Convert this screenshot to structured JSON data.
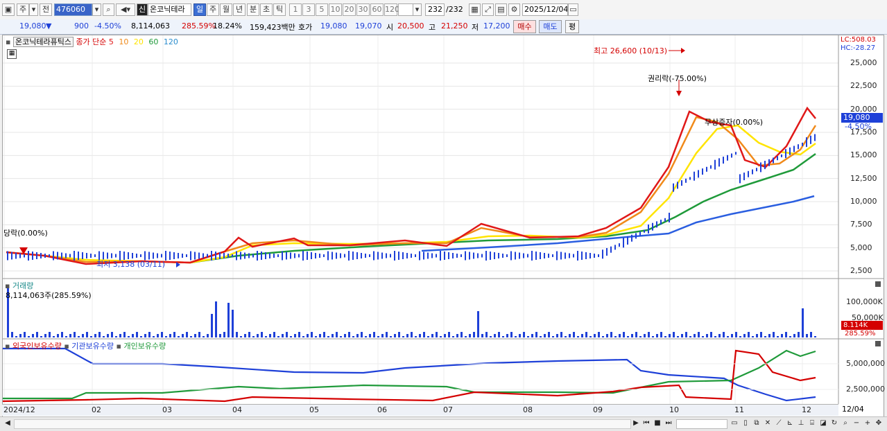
{
  "toolbar": {
    "market": "주",
    "prev_label": "전",
    "stock_code": "476060",
    "stock_name": "온코닉테라",
    "new_badge": "신",
    "periods": [
      "일",
      "주",
      "월",
      "년",
      "분",
      "초",
      "틱"
    ],
    "active_period": "일",
    "intervals": [
      "1",
      "3",
      "5",
      "10",
      "20",
      "30",
      "60",
      "120"
    ],
    "count": "232",
    "count_total": "/232",
    "date": "2025/12/04"
  },
  "info": {
    "price": "19,080",
    "price_arrow": "▼",
    "change": "900",
    "change_rate": "-4.50%",
    "volume": "8,114,063",
    "volume_rate": "285.59%",
    "turnover_rate": "18.24%",
    "trade_value": "159,423백만",
    "bid_label": "호가",
    "bid1": "19,080",
    "bid2": "19,070",
    "open_label": "시",
    "open": "20,500",
    "high_label": "고",
    "high": "21,250",
    "low_label": "저",
    "low": "17,200",
    "buy_label": "매수",
    "sell_label": "매도",
    "eval_label": "평"
  },
  "price_panel": {
    "stock_title": "온코닉테라퓨틱스",
    "ma_label": "종가 단순",
    "ma_periods": [
      {
        "label": "5",
        "color": "#e01818"
      },
      {
        "label": "10",
        "color": "#f08a1a"
      },
      {
        "label": "20",
        "color": "#ffe400"
      },
      {
        "label": "60",
        "color": "#1f9a3a"
      },
      {
        "label": "120",
        "color": "#2a5ee0"
      }
    ],
    "lc_label": "LC:508.03",
    "hc_label": "HC:-28.27",
    "y_ticks": [
      "25,000",
      "22,500",
      "20,000",
      "17,500",
      "15,000",
      "12,500",
      "10,000",
      "7,500",
      "5,000",
      "2,500"
    ],
    "current_price_tag": "19,080",
    "current_rate_tag": "-4.50%",
    "annotations": {
      "high": "최고 26,600 (10/13)",
      "rights": "권리락(-75.00%)",
      "bonus": "무상증자(0.00%)",
      "delist": "당락(0.00%)",
      "low": "최저 3,138 (03/11)"
    }
  },
  "volume_panel": {
    "title": "거래량",
    "summary": "8,114,063주(285.59%)",
    "y_ticks": [
      "100,000K",
      "50,000K"
    ],
    "tag_value": "8.114K",
    "tag_rate": "285.59%"
  },
  "holding_panel": {
    "series": [
      {
        "label": "외국인보유수량",
        "color": "#d40000"
      },
      {
        "label": "기관보유수량",
        "color": "#1e40d8"
      },
      {
        "label": "개인보유수량",
        "color": "#1f9a3a"
      }
    ],
    "y_ticks": [
      "5,000,000",
      "2,500,000"
    ]
  },
  "x_axis": {
    "labels": [
      "2024/12",
      "02",
      "03",
      "04",
      "05",
      "06",
      "07",
      "08",
      "09",
      "10",
      "11",
      "12"
    ],
    "right_label": "12/04"
  }
}
